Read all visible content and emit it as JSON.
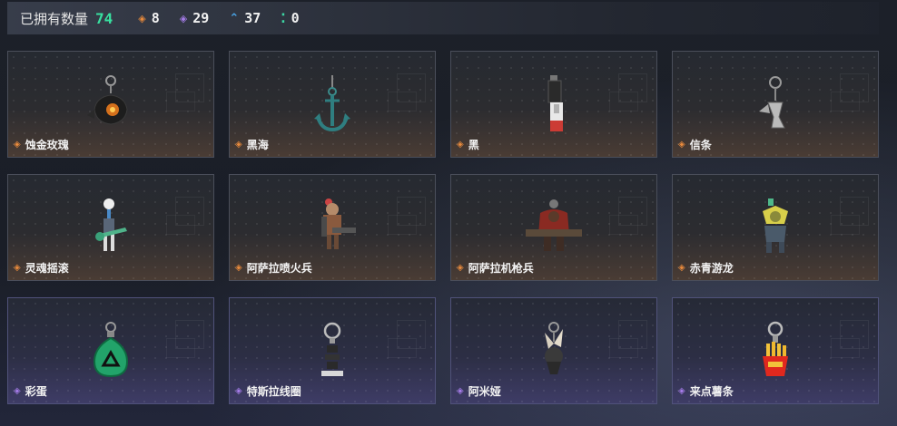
{
  "header": {
    "owned_label": "已拥有数量",
    "owned_count": "74",
    "stats": [
      {
        "icon": "orange-diamond-icon",
        "value": "8",
        "color": "#e88a3c",
        "glyph": "◈"
      },
      {
        "icon": "purple-diamond-icon",
        "value": "29",
        "color": "#a57ce8",
        "glyph": "◈"
      },
      {
        "icon": "blue-chevron-icon",
        "value": "37",
        "color": "#4aa6e8",
        "glyph": "⌃"
      },
      {
        "icon": "green-dots-icon",
        "value": "0",
        "color": "#3dd6a3",
        "glyph": "⁚"
      }
    ]
  },
  "items": [
    {
      "name": "蚀金玫瑰",
      "rarity": "orange",
      "icon": "rose-charm-icon"
    },
    {
      "name": "黑海",
      "rarity": "orange",
      "icon": "anchor-charm-icon"
    },
    {
      "name": "黑",
      "rarity": "orange",
      "icon": "lighter-charm-icon"
    },
    {
      "name": "信条",
      "rarity": "orange",
      "icon": "bird-charm-icon"
    },
    {
      "name": "灵魂摇滚",
      "rarity": "orange",
      "icon": "skeleton-guitar-charm-icon"
    },
    {
      "name": "阿萨拉喷火兵",
      "rarity": "orange",
      "icon": "flamethrower-soldier-charm-icon"
    },
    {
      "name": "阿萨拉机枪兵",
      "rarity": "orange",
      "icon": "machinegun-soldier-charm-icon"
    },
    {
      "name": "赤青游龙",
      "rarity": "orange",
      "icon": "dragon-charm-icon"
    },
    {
      "name": "彩蛋",
      "rarity": "purple",
      "icon": "egg-charm-icon"
    },
    {
      "name": "特斯拉线圈",
      "rarity": "purple",
      "icon": "tesla-coil-charm-icon"
    },
    {
      "name": "阿米娅",
      "rarity": "purple",
      "icon": "bunny-charm-icon"
    },
    {
      "name": "来点薯条",
      "rarity": "purple",
      "icon": "fries-charm-icon"
    }
  ]
}
